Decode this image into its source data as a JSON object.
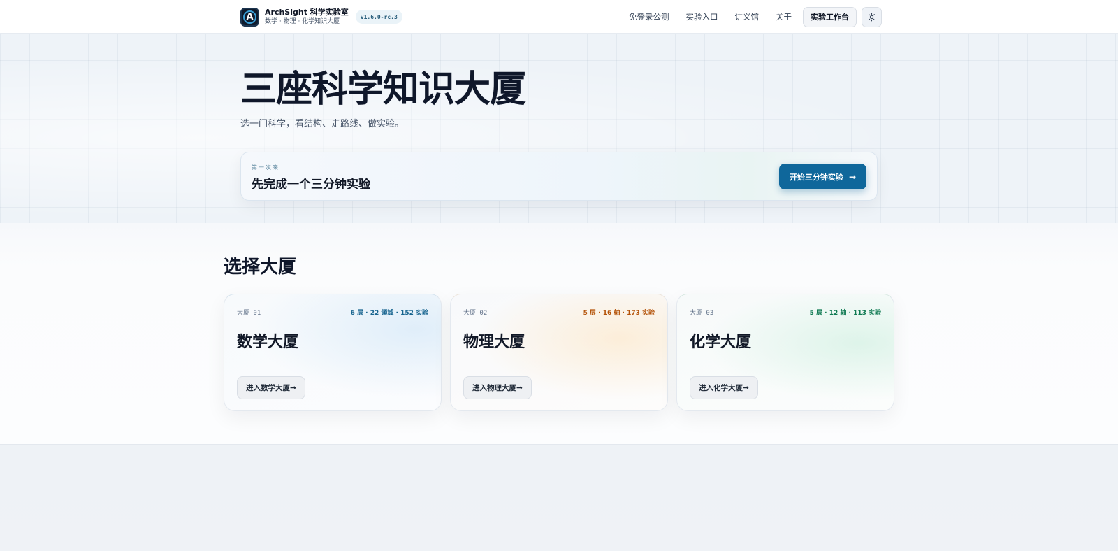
{
  "header": {
    "brand_title": "ArchSight 科学实验室",
    "brand_subtitle": "数学 · 物理 · 化学知识大厦",
    "version": "v1.6.0-rc.3",
    "nav": [
      "免登录公测",
      "实验入口",
      "讲义馆",
      "关于"
    ],
    "workbench_label": "实验工作台",
    "theme_icon": "sun-icon"
  },
  "hero": {
    "title": "三座科学知识大厦",
    "subtitle": "选一门科学，看结构、走路线、做实验。",
    "quick_start": {
      "kicker": "第一次来",
      "title": "先完成一个三分钟实验",
      "button": "开始三分钟实验",
      "button_arrow": "→"
    }
  },
  "buildings": {
    "title": "选择大厦",
    "cards": [
      {
        "tag": "大厦 01",
        "stats": "6 层 · 22 领域 · 152 实验",
        "title": "数学大厦",
        "button": "进入数学大厦→",
        "accent": "#17648f"
      },
      {
        "tag": "大厦 02",
        "stats": "5 层 · 16 轴 · 173 实验",
        "title": "物理大厦",
        "button": "进入物理大厦→",
        "accent": "#b45309"
      },
      {
        "tag": "大厦 03",
        "stats": "5 层 · 12 轴 · 113 实验",
        "title": "化学大厦",
        "button": "进入化学大厦→",
        "accent": "#0f7a52"
      }
    ]
  },
  "colors": {
    "primary": "#0f679b",
    "ink": "#0f172a"
  }
}
